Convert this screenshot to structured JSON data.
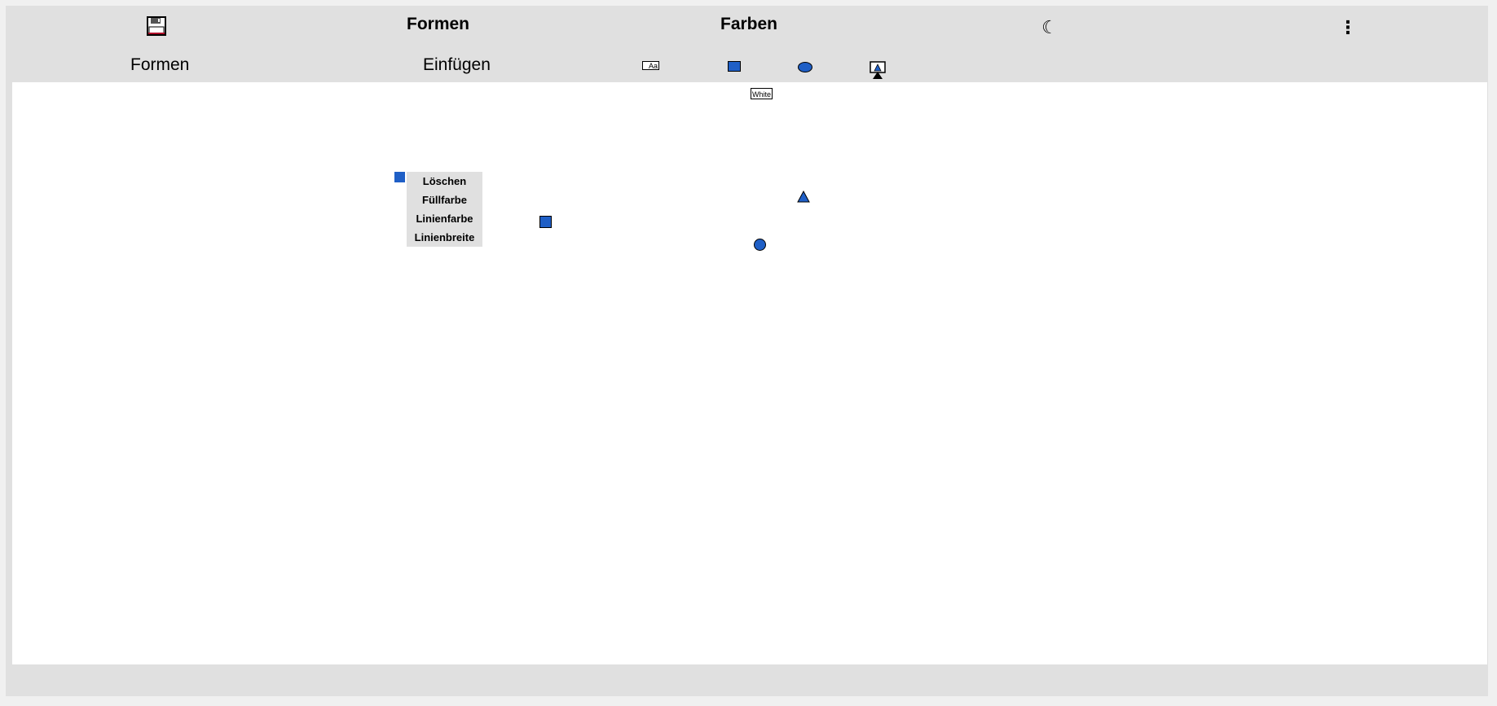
{
  "menubar": {
    "save_icon": "floppy-disk-icon",
    "shapes_menu": "Formen",
    "colors_menu": "Farben",
    "theme_icon": "moon-icon",
    "more_icon": "more-vertical-icon",
    "more_glyph": "⋮",
    "moon_glyph": "☾"
  },
  "toolbar": {
    "shapes_label": "Formen",
    "insert_label": "Einfügen",
    "tools": [
      {
        "name": "text-tool",
        "label": "Aa"
      },
      {
        "name": "rectangle-tool"
      },
      {
        "name": "ellipse-tool"
      },
      {
        "name": "image-tool"
      }
    ]
  },
  "canvas": {
    "color_tag": "White",
    "shapes": [
      {
        "type": "square",
        "fill": "#1f5fc6"
      },
      {
        "type": "circle",
        "fill": "#1f5fc6"
      },
      {
        "type": "triangle",
        "fill": "#1f5fc6"
      }
    ]
  },
  "context_menu": {
    "items": [
      "Löschen",
      "Füllfarbe",
      "Linienfarbe",
      "Linienbreite"
    ]
  },
  "colors": {
    "background": "#e0e0e0",
    "canvas": "#ffffff",
    "shape_fill": "#1f5fc6"
  }
}
